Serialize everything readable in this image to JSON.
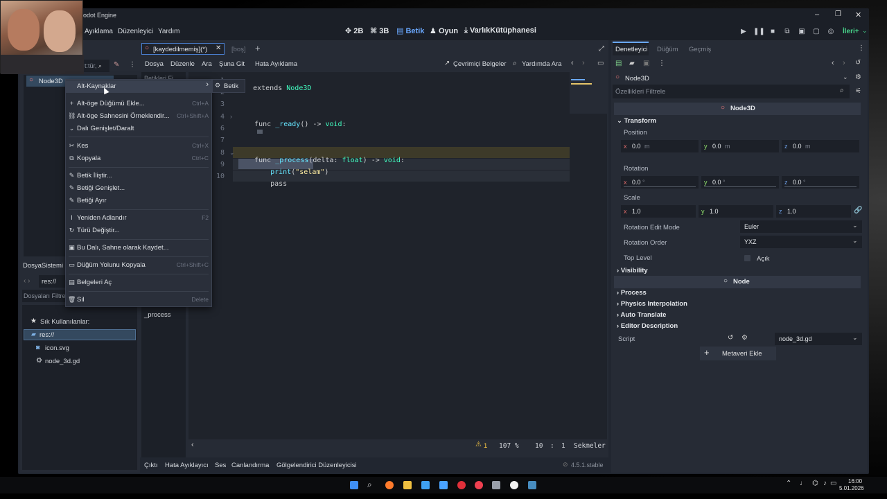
{
  "window": {
    "title": "odot Engine",
    "controls": {
      "minimize": "–",
      "maximize": "❐",
      "close": "✕"
    }
  },
  "menu": {
    "items": [
      "Ayıklama",
      "Düzenleyici",
      "Yardım"
    ]
  },
  "workspaces": [
    {
      "label": "2B",
      "icon": "✥"
    },
    {
      "label": "3B",
      "icon": "⌘"
    },
    {
      "label": "Betik",
      "icon": "▤"
    },
    {
      "label": "Oyun",
      "icon": "♟"
    },
    {
      "label": "VarlıkKütüphanesi",
      "icon": "⤓"
    }
  ],
  "run_bar": {
    "renderer": "İleri+"
  },
  "scene_panel": {
    "filter_placeholder": "t:tür,",
    "root_node": "Node3D"
  },
  "script_tabs": {
    "active": "[kaydedilmemiş](*)",
    "inactive": "[boş]",
    "add": "+"
  },
  "script_menu": {
    "items": [
      "Dosya",
      "Düzenle",
      "Ara",
      "Şuna Git",
      "Hata Ayıklama"
    ],
    "online_docs": "Çevrimiçi Belgeler",
    "search_help": "Yardımda Ara"
  },
  "script_list": {
    "filter_placeholder": "Betikleri Fi",
    "method": "_process"
  },
  "context_menu": {
    "items": [
      {
        "icon": "",
        "label": "Alt-Kaynaklar",
        "shortcut": "›"
      },
      {
        "icon": "+",
        "label": "Alt-öge Düğümü Ekle...",
        "shortcut": "Ctrl+A"
      },
      {
        "icon": "⛓",
        "label": "Alt-öge Sahnesini Örneklendir...",
        "shortcut": "Ctrl+Shift+A"
      },
      {
        "icon": "⌄",
        "label": "Dalı Genişlet/Daralt",
        "shortcut": ""
      },
      {
        "icon": "✂",
        "label": "Kes",
        "shortcut": "Ctrl+X"
      },
      {
        "icon": "⧉",
        "label": "Kopyala",
        "shortcut": "Ctrl+C"
      },
      {
        "icon": "✎",
        "label": "Betik İliştir...",
        "shortcut": ""
      },
      {
        "icon": "✎",
        "label": "Betiği Genişlet...",
        "shortcut": ""
      },
      {
        "icon": "✎",
        "label": "Betiği Ayır",
        "shortcut": ""
      },
      {
        "icon": "I",
        "label": "Yeniden Adlandır",
        "shortcut": "F2"
      },
      {
        "icon": "↻",
        "label": "Türü Değiştir...",
        "shortcut": ""
      },
      {
        "icon": "▣",
        "label": "Bu Dalı, Sahne olarak Kaydet...",
        "shortcut": ""
      },
      {
        "icon": "▭",
        "label": "Düğüm Yolunu Kopyala",
        "shortcut": "Ctrl+Shift+C"
      },
      {
        "icon": "▤",
        "label": "Belgeleri Aç",
        "shortcut": ""
      },
      {
        "icon": "🗑",
        "label": "Sil",
        "shortcut": "Delete"
      }
    ],
    "submenu_item": "Betik"
  },
  "code": {
    "lines": [
      {
        "n": "1",
        "t": "extends Node3D"
      },
      {
        "n": "2",
        "t": ""
      },
      {
        "n": "3",
        "t": ""
      },
      {
        "n": "4",
        "t": "func _ready() -> void:"
      },
      {
        "n": "6",
        "t": ""
      },
      {
        "n": "7",
        "t": ""
      },
      {
        "n": "8",
        "t": "func _process(delta: float) -> void:"
      },
      {
        "n": "9",
        "t": "print(\"selam\")"
      },
      {
        "n": "10",
        "t": "pass"
      }
    ]
  },
  "status": {
    "warnings": "1",
    "zoom": "107 %",
    "line": "10",
    "col": "1",
    "indent": "Sekmeler"
  },
  "bottom_tabs": [
    "Çıktı",
    "Hata Ayıklayıcı",
    "Ses",
    "Canlandırma",
    "Gölgelendirici Düzenleyicisi"
  ],
  "version": "4.5.1.stable",
  "filesystem": {
    "title": "DosyaSistemi",
    "path": "res://",
    "filter_placeholder": "Dosyaları Filtre",
    "favorites": "Sık Kullanılanlar:",
    "root": "res://",
    "files": [
      "icon.svg",
      "node_3d.gd"
    ]
  },
  "inspector": {
    "tabs": [
      "Denetleyici",
      "Düğüm",
      "Geçmiş"
    ],
    "node_name": "Node3D",
    "filter_placeholder": "Özellikleri Filtrele",
    "class_header": "Node3D",
    "transform": "Transform",
    "position_label": "Position",
    "position": {
      "x": "0.0",
      "y": "0.0",
      "z": "0.0",
      "unit": "m"
    },
    "rotation_label": "Rotation",
    "rotation": {
      "x": "0.0",
      "y": "0.0",
      "z": "0.0",
      "unit": "°"
    },
    "scale_label": "Scale",
    "scale": {
      "x": "1.0",
      "y": "1.0",
      "z": "1.0"
    },
    "rotation_edit_mode_label": "Rotation Edit Mode",
    "rotation_edit_mode": "Euler",
    "rotation_order_label": "Rotation Order",
    "rotation_order": "YXZ",
    "top_level_label": "Top Level",
    "top_level_value": "Açık",
    "visibility": "Visibility",
    "node_header": "Node",
    "process": "Process",
    "physics_interpolation": "Physics Interpolation",
    "auto_translate": "Auto Translate",
    "editor_description": "Editor Description",
    "script_label": "Script",
    "script_value": "node_3d.gd",
    "add_metadata": "Metaveri Ekle"
  },
  "taskbar": {
    "time": "16:00",
    "date": "5.01.2026"
  },
  "colors": {
    "accent": "#6aa8ff",
    "panel": "#262b35",
    "editor": "#1f232b"
  }
}
